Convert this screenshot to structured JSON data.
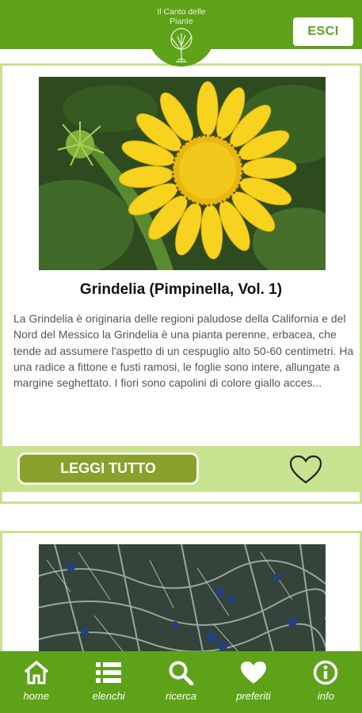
{
  "header": {
    "logo_line1": "Il Canto delle",
    "logo_line2": "Piante",
    "exit_label": "ESCI"
  },
  "cards": [
    {
      "image": "yellow-flower-photo",
      "title": "Grindelia (Pimpinella, Vol. 1)",
      "description": "La Grindelia è originaria delle regioni paludose della California e del Nord del Messico la Grindelia è una pianta perenne, erbacea, che tende ad assumere l'aspetto di un cespuglio alto 50-60 centimetri. Ha una radice a fittone e fusti ramosi, le foglie sono intere, allungate a margine seghettato. I fiori sono capolini di colore giallo acces...",
      "read_more_label": "LEGGI TUTTO",
      "favorite_icon": "heart-outline-icon"
    },
    {
      "image": "juniper-berries-photo"
    }
  ],
  "nav": [
    {
      "label": "home",
      "icon": "home-icon"
    },
    {
      "label": "elenchi",
      "icon": "list-icon"
    },
    {
      "label": "ricerca",
      "icon": "search-icon"
    },
    {
      "label": "preferiti",
      "icon": "heart-icon"
    },
    {
      "label": "info",
      "icon": "info-icon"
    }
  ],
  "colors": {
    "primary": "#5ea21a",
    "card_border": "#c7e28e",
    "action_bar": "#c8e38f",
    "read_button": "#87a12a"
  }
}
